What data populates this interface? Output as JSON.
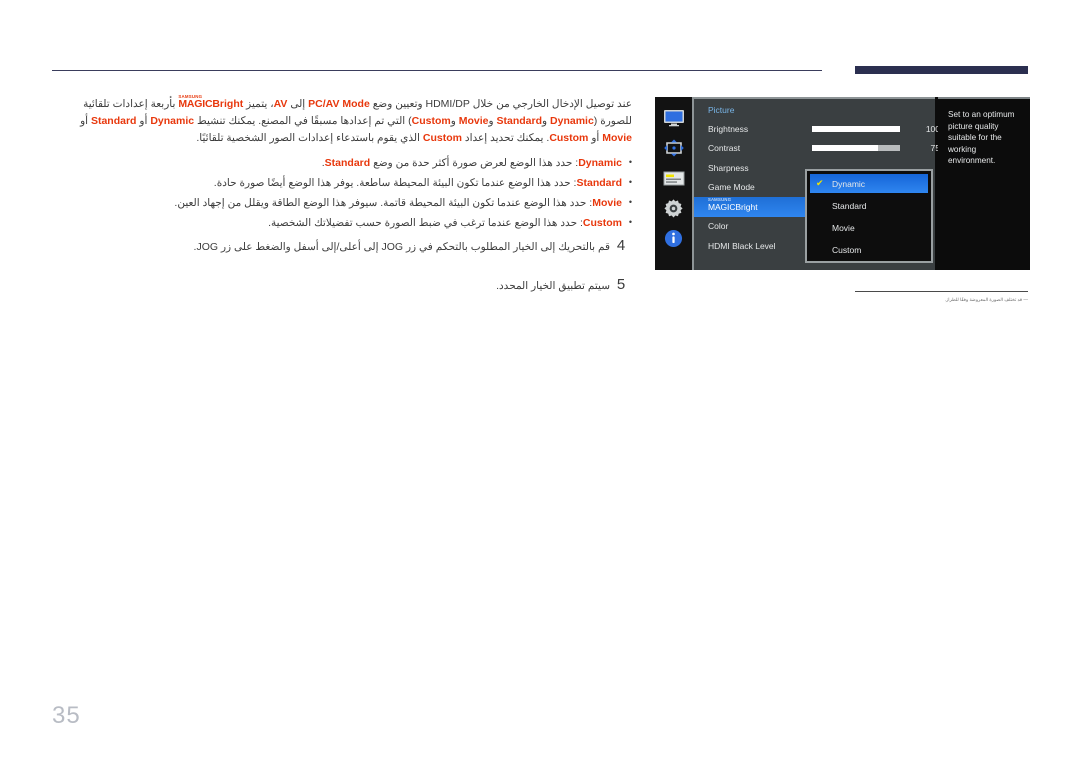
{
  "page": {
    "number": "35",
    "footnote": "― قد تختلف الصورة المعروضة وفقًا للطراز."
  },
  "body": {
    "intro_line1_a": "عند توصيل الإدخال الخارجي من خلال HDMI/DP وتعيين وضع ",
    "intro_pcav": "PC/AV Mode",
    "intro_line1_b": " إلى ",
    "intro_av": "AV",
    "intro_line1_c": "، يتميز ",
    "magic_sup": "SAMSUNG",
    "magic_mg": "MAGIC",
    "magic_bright": "Bright",
    "intro_line1_d": " بأربعة إعدادات تلقائية للصورة (",
    "kw_dynamic": "Dynamic",
    "sep_and_1": " و",
    "kw_standard": "Standard",
    "sep_and_2": " و",
    "kw_movie": "Movie",
    "sep_and_3": " و",
    "kw_custom": "Custom",
    "intro_line2_b": ") التي تم إعدادها مسبقًا في المصنع. يمكنك تنشيط ",
    "intro_line2_c": " أو ",
    "intro_line2_d": " أو ",
    "intro_line2_e": " أو ",
    "intro_line3_a": ". يمكنك تحديد إعداد ",
    "intro_line3_b": " الذي يقوم باستدعاء إعدادات الصور الشخصية تلقائيًا."
  },
  "bullets": [
    {
      "key": "Dynamic",
      "text_before": ": حدد هذا الوضع لعرض صورة أكثر حدة من وضع ",
      "key2": "Standard",
      "text_after": "."
    },
    {
      "key": "Standard",
      "text_before": ": حدد هذا الوضع عندما تكون البيئة المحيطة ساطعة. يوفر هذا الوضع أيضًا صورة حادة.",
      "key2": "",
      "text_after": ""
    },
    {
      "key": "Movie",
      "text_before": ": حدد هذا الوضع عندما تكون البيئة المحيطة قاتمة. سيوفر هذا الوضع الطاقة ويقلل من إجهاد العين.",
      "key2": "",
      "text_after": ""
    },
    {
      "key": "Custom",
      "text_before": ": حدد هذا الوضع عندما ترغب في ضبط الصورة حسب تفضيلاتك الشخصية.",
      "key2": "",
      "text_after": ""
    }
  ],
  "steps": [
    {
      "num": "4",
      "text": "قم بالتحريك إلى الخيار المطلوب بالتحكم في زر JOG إلى أعلى/إلى أسفل والضغط على زر JOG."
    },
    {
      "num": "5",
      "text": "سيتم تطبيق الخيار المحدد."
    }
  ],
  "osd": {
    "title": "Picture",
    "icons": [
      {
        "name": "display-icon",
        "label": "Display"
      },
      {
        "name": "position-arrows-icon",
        "label": "Position"
      },
      {
        "name": "onscreen-display-icon",
        "label": "OnScreen Display"
      },
      {
        "name": "gear-icon",
        "label": "System"
      },
      {
        "name": "info-icon",
        "label": "Information"
      }
    ],
    "items": [
      {
        "label": "Brightness",
        "type": "slider",
        "value": "100",
        "fill_pct": 100
      },
      {
        "label": "Contrast",
        "type": "slider",
        "value": "75",
        "fill_pct": 75
      },
      {
        "label": "Sharpness",
        "type": "plain"
      },
      {
        "label": "Game Mode",
        "type": "plain"
      },
      {
        "label": "MAGICBright",
        "type": "magic",
        "selected": true
      },
      {
        "label": "Color",
        "type": "plain"
      },
      {
        "label": "HDMI Black Level",
        "type": "plain"
      }
    ],
    "submenu": {
      "check_glyph": "✔",
      "options": [
        {
          "label": "Dynamic",
          "selected": true
        },
        {
          "label": "Standard",
          "selected": false
        },
        {
          "label": "Movie",
          "selected": false
        },
        {
          "label": "Custom",
          "selected": false
        }
      ]
    },
    "help_text": "Set to an optimum picture quality suitable for the working environment."
  },
  "colors": {
    "keyword_red": "#e8380d",
    "osd_panel": "#3a3f41",
    "osd_highlight": "#2f86f0",
    "osd_title_blue": "#79b6e8",
    "check_yellow": "#f2e500",
    "header_bar": "#2b2f50"
  }
}
